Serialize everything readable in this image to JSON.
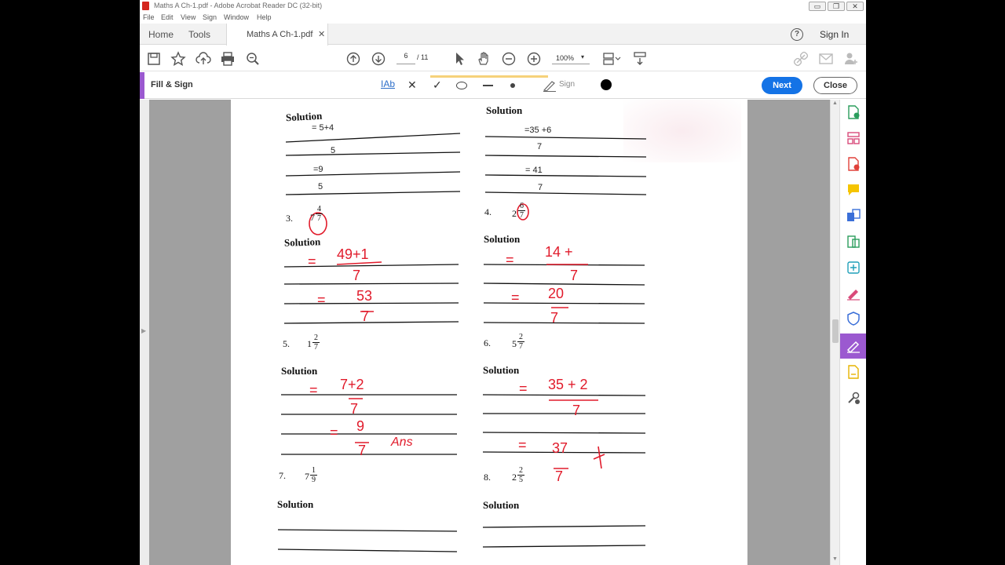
{
  "window": {
    "title": "Maths A Ch-1.pdf - Adobe Acrobat Reader DC (32-bit)",
    "buttons": [
      "▭",
      "❐",
      "✕"
    ]
  },
  "menu": [
    "File",
    "Edit",
    "View",
    "Sign",
    "Window",
    "Help"
  ],
  "nav": {
    "home": "Home",
    "tools": "Tools",
    "doc_tab": "Maths A Ch-1.pdf",
    "doc_tab_close": "✕",
    "help": "?",
    "sign_in": "Sign In"
  },
  "toolbar": {
    "page_current": "6",
    "page_total": "/ 11",
    "zoom": "100%",
    "zoom_caret": "▾"
  },
  "fill_sign": {
    "title": "Fill & Sign",
    "text_tool": "IAb",
    "cross_tool": "✕",
    "check_tool": "✓",
    "sign_label": "Sign",
    "next": "Next",
    "close": "Close",
    "accent": "#9b59d0",
    "next_color": "#1473e6"
  },
  "worksheet": {
    "solution_label": "Solution",
    "q_top_left": [
      "= 5+4",
      "5",
      "=9",
      "5"
    ],
    "q_top_right": [
      "=35 +6",
      "7",
      "= 41",
      "7"
    ],
    "questions": [
      {
        "num": "3.",
        "whole": "7",
        "numer": "4",
        "denom": "7"
      },
      {
        "num": "4.",
        "whole": "2",
        "numer": "6",
        "denom": "7"
      },
      {
        "num": "5.",
        "whole": "1",
        "numer": "2",
        "denom": "7"
      },
      {
        "num": "6.",
        "whole": "5",
        "numer": "2",
        "denom": "7"
      },
      {
        "num": "7.",
        "whole": "7",
        "numer": "1",
        "denom": "9"
      },
      {
        "num": "8.",
        "whole": "2",
        "numer": "2",
        "denom": "5"
      }
    ],
    "handwriting": {
      "q3": [
        "=",
        "49+1",
        "7",
        "=",
        "53",
        "7"
      ],
      "q4": [
        "=",
        "14 +",
        "7",
        "=",
        "20",
        "7"
      ],
      "q5": [
        "=",
        "7+2",
        "7",
        "=",
        "9",
        "7",
        "Ans"
      ],
      "q6": [
        "=",
        "35 + 2",
        "7",
        "=",
        "37",
        "7"
      ]
    },
    "ink_color": "#e11b2b"
  }
}
